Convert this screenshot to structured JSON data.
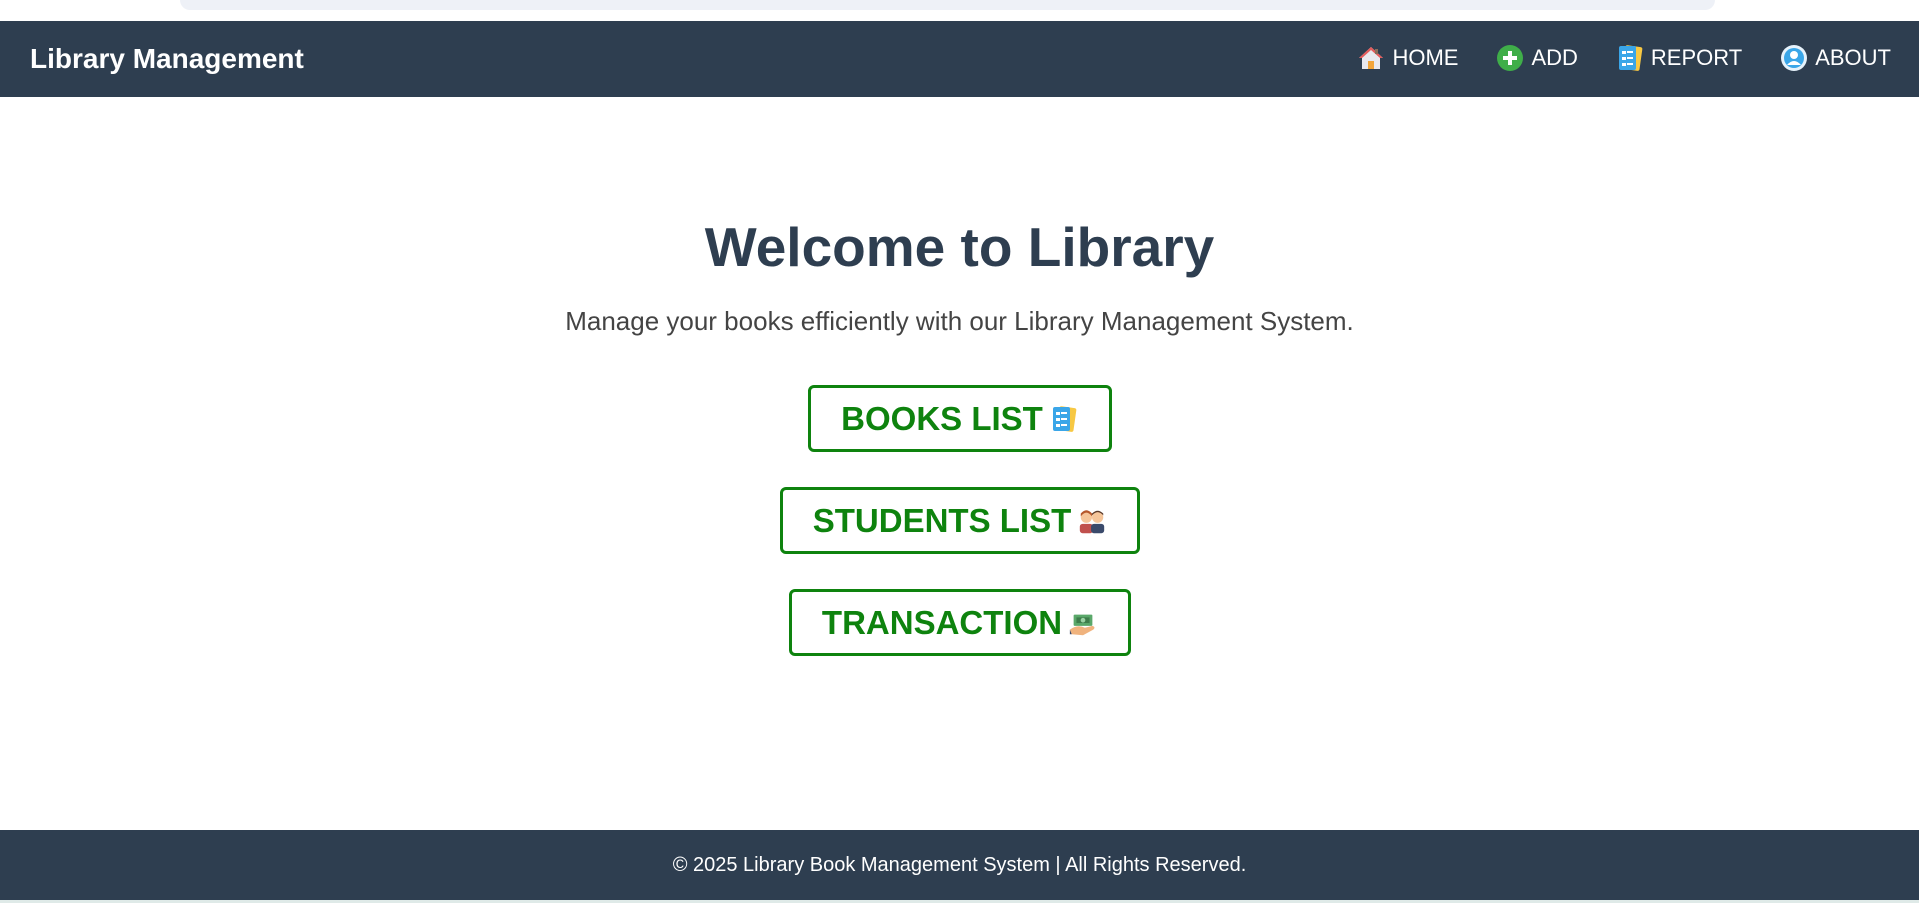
{
  "navbar": {
    "brand": "Library Management",
    "links": [
      {
        "label": "HOME",
        "icon": "house-icon"
      },
      {
        "label": "ADD",
        "icon": "plus-circle-icon"
      },
      {
        "label": "REPORT",
        "icon": "report-icon"
      },
      {
        "label": "ABOUT",
        "icon": "user-circle-icon"
      }
    ]
  },
  "main": {
    "title": "Welcome to Library",
    "subtitle": "Manage your books efficiently with our Library Management System.",
    "buttons": [
      {
        "label": "BOOKS LIST",
        "icon": "report-icon"
      },
      {
        "label": "STUDENTS LIST",
        "icon": "students-icon"
      },
      {
        "label": "TRANSACTION",
        "icon": "money-hand-icon"
      }
    ]
  },
  "footer": {
    "text": "© 2025 Library Book Management System | All Rights Reserved."
  },
  "colors": {
    "navbar_bg": "#2e3e50",
    "title": "#2e3e50",
    "button_green": "#0e830e",
    "add_icon_green": "#3fae49",
    "report_icon_blue": "#3aa6e8"
  }
}
